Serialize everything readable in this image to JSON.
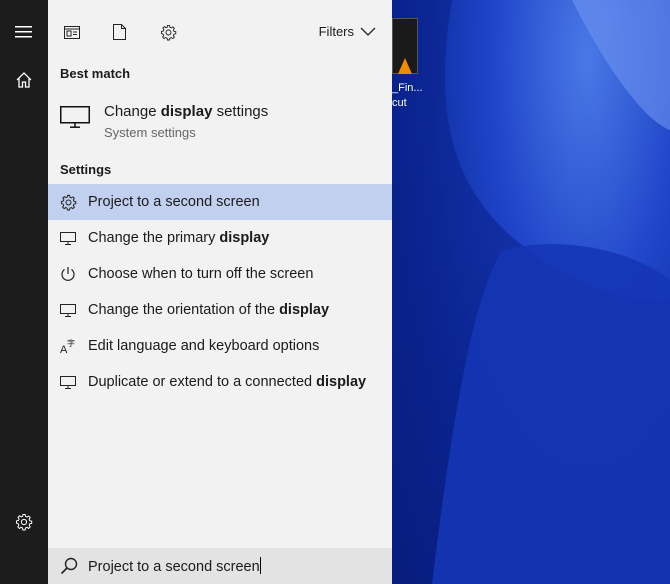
{
  "desktop": {
    "icon_label_1": "_Fin...",
    "icon_label_2": "cut"
  },
  "rail": {
    "items": [
      {
        "icon": "hamburger-menu-icon"
      },
      {
        "icon": "home-icon"
      },
      {
        "icon": "gear-icon"
      }
    ]
  },
  "topbar": {
    "icons": [
      "apps-icon",
      "document-icon",
      "gear-icon"
    ],
    "filters_label": "Filters"
  },
  "best_match": {
    "heading": "Best match",
    "title_prefix": "Change ",
    "title_bold": "display",
    "title_suffix": " settings",
    "subtitle": "System settings"
  },
  "settings": {
    "heading": "Settings",
    "items": [
      {
        "icon": "gear-icon",
        "pre": "Project to a second screen",
        "bold": "",
        "post": "",
        "selected": true
      },
      {
        "icon": "monitor-icon",
        "pre": "Change the primary ",
        "bold": "display",
        "post": "",
        "selected": false
      },
      {
        "icon": "power-icon",
        "pre": "Choose when to turn off the screen",
        "bold": "",
        "post": "",
        "selected": false
      },
      {
        "icon": "monitor-icon",
        "pre": "Change the orientation of the ",
        "bold": "display",
        "post": "",
        "selected": false
      },
      {
        "icon": "language-icon",
        "pre": "Edit language and keyboard options",
        "bold": "",
        "post": "",
        "selected": false
      },
      {
        "icon": "monitor-icon",
        "pre": "Duplicate or extend to a connected ",
        "bold": "display",
        "post": "",
        "selected": false
      }
    ]
  },
  "search": {
    "value": "Project to a second screen"
  },
  "colors": {
    "selected_row": "#c2d0ef",
    "rail_bg": "#1c1c1c",
    "panel_bg": "#f2f2f2"
  }
}
